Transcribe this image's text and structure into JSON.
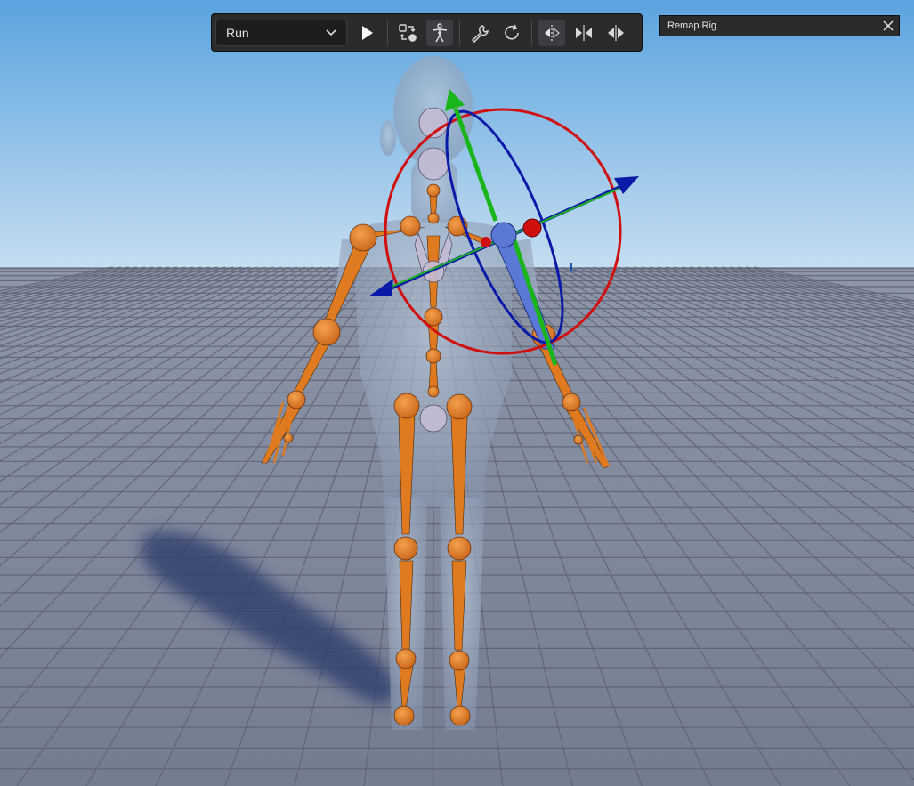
{
  "toolbar": {
    "mode_select": {
      "value": "Run",
      "icon": "chevron-down-icon"
    },
    "buttons": [
      {
        "name": "play-button",
        "icon": "play-icon",
        "active": false
      },
      {
        "name": "swap-target-button",
        "icon": "swap-shapes-icon",
        "active": false
      },
      {
        "name": "rig-figure-button",
        "icon": "humanoid-figure-icon",
        "active": true
      },
      {
        "name": "settings-button",
        "icon": "wrench-icon",
        "active": false
      },
      {
        "name": "reset-button",
        "icon": "rotate-icon",
        "active": false
      },
      {
        "name": "mirror-left-button",
        "icon": "mirror-left-icon",
        "active": true
      },
      {
        "name": "mirror-center-button",
        "icon": "mirror-both-icon",
        "active": false
      },
      {
        "name": "mirror-right-button",
        "icon": "mirror-right-icon",
        "active": false
      }
    ]
  },
  "remap_panel": {
    "title": "Remap Rig",
    "close_icon": "close-icon"
  },
  "scene": {
    "sky_top": "#5aa3df",
    "sky_bottom": "#c6def1",
    "ground_color": "#7b8396",
    "grid_line_color": "#5c6274",
    "bone_color": "#e07a20",
    "joint_color": "#e68a2e",
    "gizmo_colors": {
      "x": "#d00f0f",
      "y": "#1ab51a",
      "z": "#0a1aa8"
    },
    "local_space_label": "L"
  }
}
